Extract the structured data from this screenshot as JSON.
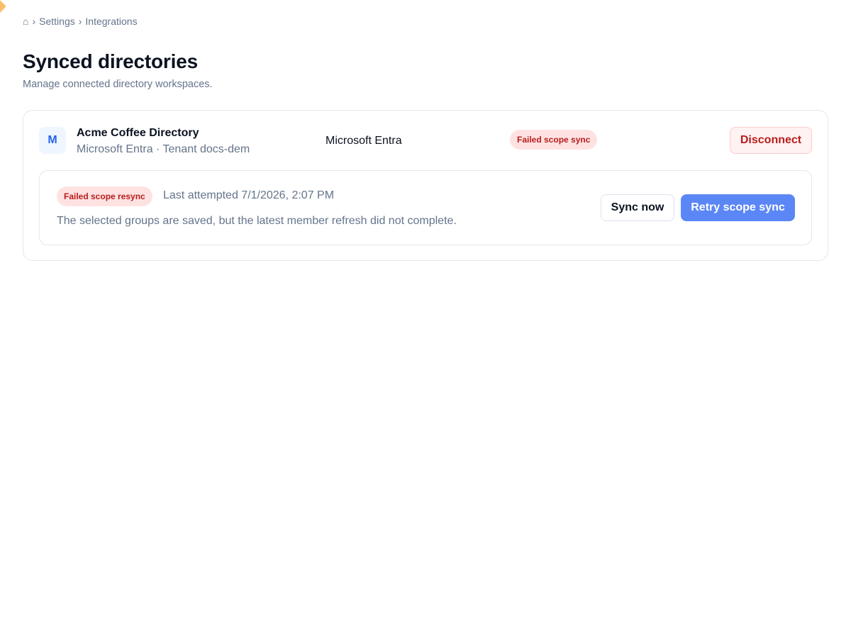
{
  "breadcrumb": {
    "home_icon": "⌂",
    "separator": "›",
    "items": [
      "Settings",
      "Integrations"
    ]
  },
  "page": {
    "title": "Synced directories",
    "subtitle": "Manage connected directory workspaces."
  },
  "directory": {
    "avatar_letter": "M",
    "name": "Acme Coffee Directory",
    "meta": "Microsoft Entra · Tenant docs-dem",
    "provider": "Microsoft Entra",
    "status": "Failed scope sync",
    "disconnect_label": "Disconnect"
  },
  "alert": {
    "badge": "Failed scope resync",
    "last_attempted": "Last attempted 7/1/2026, 2:07 PM",
    "message": "The selected groups are saved, but the latest member refresh did not complete.",
    "sync_now_label": "Sync now",
    "retry_label": "Retry scope sync"
  },
  "colors": {
    "primary": "#5b86f5",
    "danger": "#b91c1c",
    "danger_bg": "#fee2e2",
    "muted_text": "#64748b"
  }
}
